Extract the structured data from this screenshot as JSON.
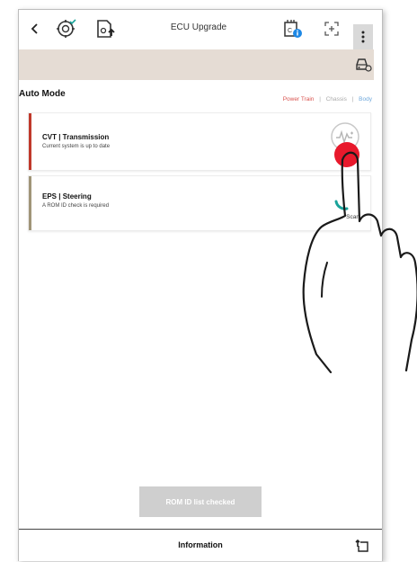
{
  "topbar": {
    "back_icon": "chevron-left-icon",
    "title": "ECU Upgrade",
    "icons": [
      "diagnostic-gear-icon",
      "vehicle-upload-icon",
      "ecu-info-icon",
      "fullscreen-icon",
      "more-vertical-icon"
    ]
  },
  "subbar": {
    "icon": "car-settings-icon"
  },
  "auto_mode": {
    "title": "Auto Mode",
    "filters": [
      {
        "label": "Power Train",
        "active": true
      },
      {
        "label": "Chassis",
        "active": false
      },
      {
        "label": "Body",
        "active": false
      }
    ],
    "separator": "|"
  },
  "systems": [
    {
      "name": "CVT  |  Transmission",
      "description": "Current system is up to date",
      "accent_color": "#c0392b",
      "status_icon": "waveform-check-icon"
    },
    {
      "name": "EPS  |  Steering",
      "description": "A ROM ID check is required",
      "accent_color": "#a09578",
      "status_icon": "scan-spinner-icon",
      "action_label": "Scan"
    }
  ],
  "rom_button": {
    "label": "ROM ID list checked"
  },
  "information": {
    "label": "Information",
    "icon": "export-icon"
  },
  "colors": {
    "accent_red": "#d9534f",
    "subbar_bg": "#e5dcd4",
    "rom_button_bg": "#cfcfcf",
    "scan_teal": "#1aa39a"
  }
}
